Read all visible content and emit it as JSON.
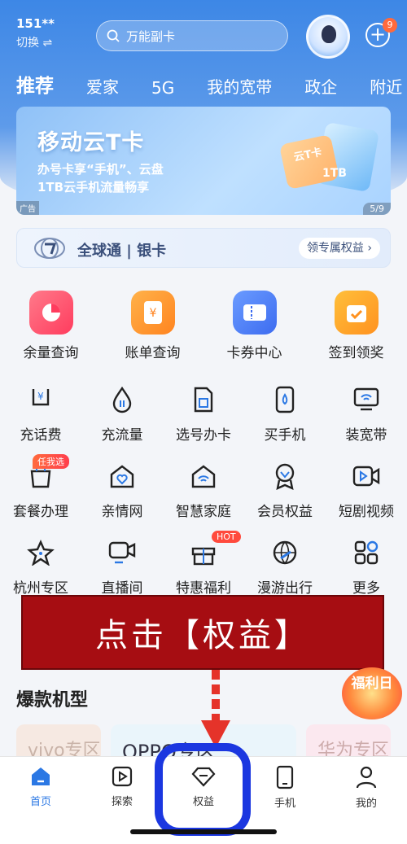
{
  "status": {
    "account": "151**",
    "switch_label": "切换 ⇌"
  },
  "search": {
    "placeholder": "万能副卡"
  },
  "notifications": {
    "count": "9"
  },
  "tabs": [
    "推荐",
    "爱家",
    "5G",
    "我的宽带",
    "政企",
    "附近"
  ],
  "banner": {
    "title": "移动云T卡",
    "line1": "办号卡享“手机”、云盘",
    "line2": "1TB云手机流量畅享",
    "card_label": "云T卡",
    "storage_label": "1TB",
    "ad_label": "广告",
    "page": "5/9"
  },
  "global_card": {
    "name": "全球通 | 银卡",
    "action": "领专属权益 ›"
  },
  "primary_grid": [
    {
      "label": "余量查询",
      "icon": "pie-chart-icon",
      "color": "#ff4a6a"
    },
    {
      "label": "账单查询",
      "icon": "bill-icon",
      "color": "#ff9a2e"
    },
    {
      "label": "卡券中心",
      "icon": "coupon-icon",
      "color": "#4a7cf5"
    },
    {
      "label": "签到领奖",
      "icon": "calendar-check-icon",
      "color": "#ffa02e"
    }
  ],
  "grid_row2": [
    {
      "label": "充话费",
      "icon": "phone-bill-icon"
    },
    {
      "label": "充流量",
      "icon": "data-drop-icon"
    },
    {
      "label": "选号办卡",
      "icon": "sim-card-icon"
    },
    {
      "label": "买手机",
      "icon": "mobile-phone-icon"
    },
    {
      "label": "装宽带",
      "icon": "broadband-monitor-icon"
    }
  ],
  "grid_row3": [
    {
      "label": "套餐办理",
      "icon": "bag-icon",
      "tag": "任我选"
    },
    {
      "label": "亲情网",
      "icon": "heart-house-icon"
    },
    {
      "label": "智慧家庭",
      "icon": "wifi-house-icon"
    },
    {
      "label": "会员权益",
      "icon": "member-badge-icon"
    },
    {
      "label": "短剧视频",
      "icon": "video-camera-icon"
    }
  ],
  "grid_row4": [
    {
      "label": "杭州专区",
      "icon": "star-icon"
    },
    {
      "label": "直播间",
      "icon": "live-camera-icon"
    },
    {
      "label": "特惠福利",
      "icon": "gift-icon",
      "tag": "HOT"
    },
    {
      "label": "漫游出行",
      "icon": "globe-plane-icon"
    },
    {
      "label": "更多",
      "icon": "more-grid-icon"
    }
  ],
  "overlay_text": "点击【权益】",
  "section_title": "爆款机型",
  "welfare_badge": "福利日",
  "brands": [
    "vivo专区",
    "OPPO专区",
    "华为专区"
  ],
  "bottom_nav": [
    {
      "label": "首页",
      "icon": "home-icon",
      "active": true
    },
    {
      "label": "探索",
      "icon": "play-icon",
      "active": false
    },
    {
      "label": "权益",
      "icon": "diamond-icon",
      "active": false
    },
    {
      "label": "手机",
      "icon": "phone-icon",
      "active": false
    },
    {
      "label": "我的",
      "icon": "person-icon",
      "active": false
    }
  ],
  "colors": {
    "brand_blue": "#3d87e6",
    "highlight_ring": "#1b37e0",
    "arrow_red": "#e5332a",
    "overlay_bg": "#a60d12"
  }
}
